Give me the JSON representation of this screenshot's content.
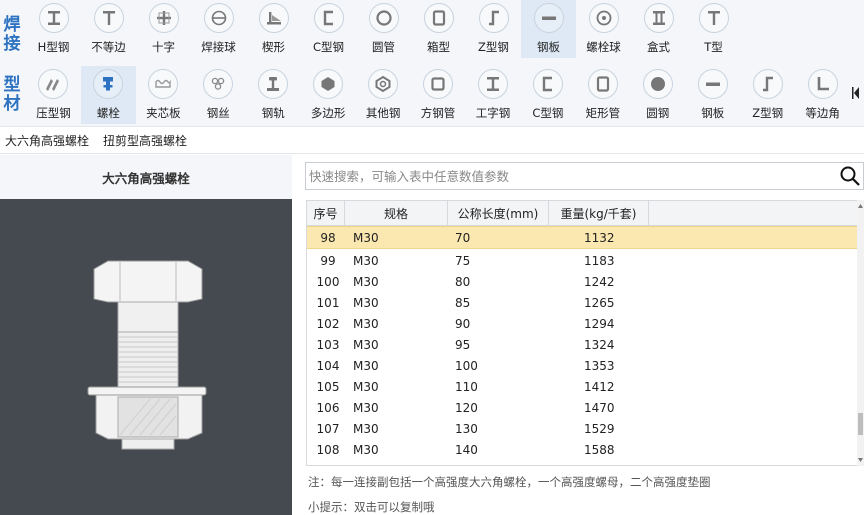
{
  "sidebar_labels": {
    "row1": "焊接",
    "row2": "型材"
  },
  "toolbar": {
    "row1": [
      {
        "label": "H型钢",
        "icon": "h-beam-icon"
      },
      {
        "label": "不等边",
        "icon": "unequal-angle-icon"
      },
      {
        "label": "十字",
        "icon": "cross-icon"
      },
      {
        "label": "焊接球",
        "icon": "welded-ball-icon"
      },
      {
        "label": "楔形",
        "icon": "wedge-icon"
      },
      {
        "label": "C型钢",
        "icon": "c-channel-icon"
      },
      {
        "label": "圆管",
        "icon": "round-pipe-icon"
      },
      {
        "label": "箱型",
        "icon": "box-section-icon"
      },
      {
        "label": "Z型钢",
        "icon": "z-section-icon"
      },
      {
        "label": "钢板",
        "icon": "steel-plate-icon"
      },
      {
        "label": "螺栓球",
        "icon": "bolt-ball-icon"
      },
      {
        "label": "盒式",
        "icon": "box-type-icon"
      },
      {
        "label": "T型",
        "icon": "t-section-icon"
      }
    ],
    "row2": [
      {
        "label": "压型钢",
        "icon": "profiled-steel-icon"
      },
      {
        "label": "螺栓",
        "icon": "bolt-icon"
      },
      {
        "label": "夹芯板",
        "icon": "sandwich-panel-icon"
      },
      {
        "label": "钢丝",
        "icon": "steel-wire-icon"
      },
      {
        "label": "钢轨",
        "icon": "rail-icon"
      },
      {
        "label": "多边形",
        "icon": "polygon-icon"
      },
      {
        "label": "其他钢",
        "icon": "other-steel-icon"
      },
      {
        "label": "方钢管",
        "icon": "square-tube-icon"
      },
      {
        "label": "工字钢",
        "icon": "i-beam-icon"
      },
      {
        "label": "C型钢",
        "icon": "c-channel-icon"
      },
      {
        "label": "矩形管",
        "icon": "rect-tube-icon"
      },
      {
        "label": "圆钢",
        "icon": "round-bar-icon"
      },
      {
        "label": "钢板",
        "icon": "steel-plate-icon"
      },
      {
        "label": "Z型钢",
        "icon": "z-section-icon"
      },
      {
        "label": "等边角",
        "icon": "equal-angle-icon"
      }
    ],
    "row1_active": "钢板",
    "row2_active": "螺栓"
  },
  "subtabs": [
    "大六角高强螺栓",
    "扭剪型高强螺栓"
  ],
  "left_panel": {
    "title": "大六角高强螺栓"
  },
  "search": {
    "placeholder": "快速搜索，可输入表中任意数值参数",
    "value": ""
  },
  "table": {
    "headers": [
      "序号",
      "规格",
      "公称长度(mm)",
      "重量(kg/千套)"
    ],
    "selected_index": 0,
    "rows": [
      [
        "98",
        "M30",
        "70",
        "1132"
      ],
      [
        "99",
        "M30",
        "75",
        "1183"
      ],
      [
        "100",
        "M30",
        "80",
        "1242"
      ],
      [
        "101",
        "M30",
        "85",
        "1265"
      ],
      [
        "102",
        "M30",
        "90",
        "1294"
      ],
      [
        "103",
        "M30",
        "95",
        "1324"
      ],
      [
        "104",
        "M30",
        "100",
        "1353"
      ],
      [
        "105",
        "M30",
        "110",
        "1412"
      ],
      [
        "106",
        "M30",
        "120",
        "1470"
      ],
      [
        "107",
        "M30",
        "130",
        "1529"
      ],
      [
        "108",
        "M30",
        "140",
        "1588"
      ]
    ]
  },
  "footer": {
    "note": "注：每一连接副包括一个高强度大六角螺栓，一个高强度螺母，二个高强度垫圈",
    "tip": "小提示：双击可以复制哦"
  },
  "colors": {
    "accent": "#2d73c2",
    "selected_row": "#fbe8b0",
    "image_bg": "#454a50"
  }
}
